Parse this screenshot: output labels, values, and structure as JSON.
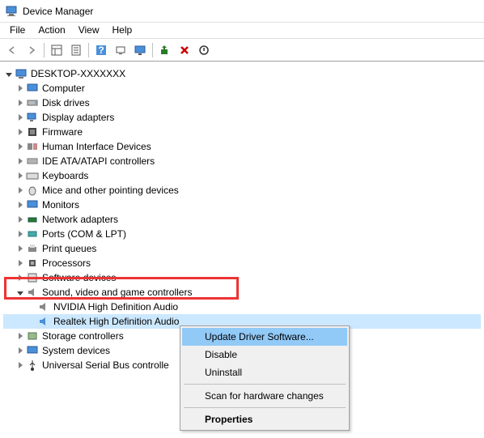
{
  "window": {
    "title": "Device Manager"
  },
  "menu": {
    "file": "File",
    "action": "Action",
    "view": "View",
    "help": "Help"
  },
  "root": "DESKTOP-XXXXXXX",
  "tree": {
    "computer": "Computer",
    "disk_drives": "Disk drives",
    "display_adapters": "Display adapters",
    "firmware": "Firmware",
    "hid": "Human Interface Devices",
    "ide": "IDE ATA/ATAPI controllers",
    "keyboards": "Keyboards",
    "mice": "Mice and other pointing devices",
    "monitors": "Monitors",
    "network": "Network adapters",
    "ports": "Ports (COM & LPT)",
    "print_queues": "Print queues",
    "processors": "Processors",
    "software_devices": "Software devices",
    "sound": "Sound, video and game controllers",
    "sound_nvidia": "NVIDIA High Definition Audio",
    "sound_realtek": "Realtek High Definition Audio",
    "storage": "Storage controllers",
    "system": "System devices",
    "usb": "Universal Serial Bus controlle"
  },
  "context": {
    "update": "Update Driver Software...",
    "disable": "Disable",
    "uninstall": "Uninstall",
    "scan": "Scan for hardware changes",
    "properties": "Properties"
  }
}
